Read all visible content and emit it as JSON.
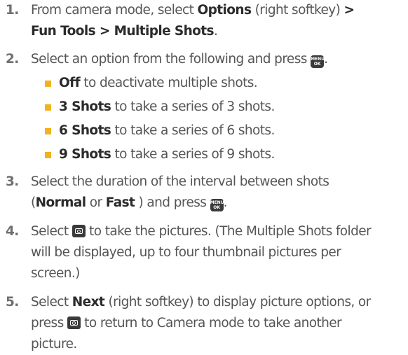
{
  "icons": {
    "menu_ok_key": "menu-ok-key-icon",
    "camera_key": "camera-key-icon",
    "bullet": "square-bullet"
  },
  "colors": {
    "bullet": "#f2b21b",
    "key": "#3a3a3a",
    "text": "#555555",
    "bold": "#2b2b2b"
  },
  "key_text": {
    "menu": "MENU",
    "ok": "OK"
  },
  "steps": [
    {
      "num": "1.",
      "p1": "From camera mode, select ",
      "b1": "Options",
      "p2": " (right softkey) ",
      "b2": ">",
      "b3": "Fun Tools > Multiple Shots",
      "p3": "."
    },
    {
      "num": "2.",
      "p1": "Select an option from the following and press ",
      "p2": "."
    },
    {
      "num": "3.",
      "p1": "Select the duration of the interval between shots",
      "p2": "(",
      "b1": "Normal",
      "p3": " or ",
      "b2": "Fast",
      "p4": " ) and press ",
      "p5": "."
    },
    {
      "num": "4.",
      "p1": "Select ",
      "p2": " to take the pictures. (The Multiple Shots folder",
      "p3": "will be displayed, up to four thumbnail pictures per",
      "p4": "screen.)"
    },
    {
      "num": "5.",
      "p1": "Select ",
      "b1": "Next",
      "p2": " (right softkey) to display picture options, or",
      "p3": "press ",
      "p4": " to return to Camera mode to take another",
      "p5": "picture."
    }
  ],
  "options": [
    {
      "bold": "Off",
      "text": " to deactivate multiple shots."
    },
    {
      "bold": "3 Shots",
      "text": " to take a series of 3 shots."
    },
    {
      "bold": "6 Shots",
      "text": " to take a series of 6 shots."
    },
    {
      "bold": "9 Shots",
      "text": " to take a series of 9 shots."
    }
  ]
}
